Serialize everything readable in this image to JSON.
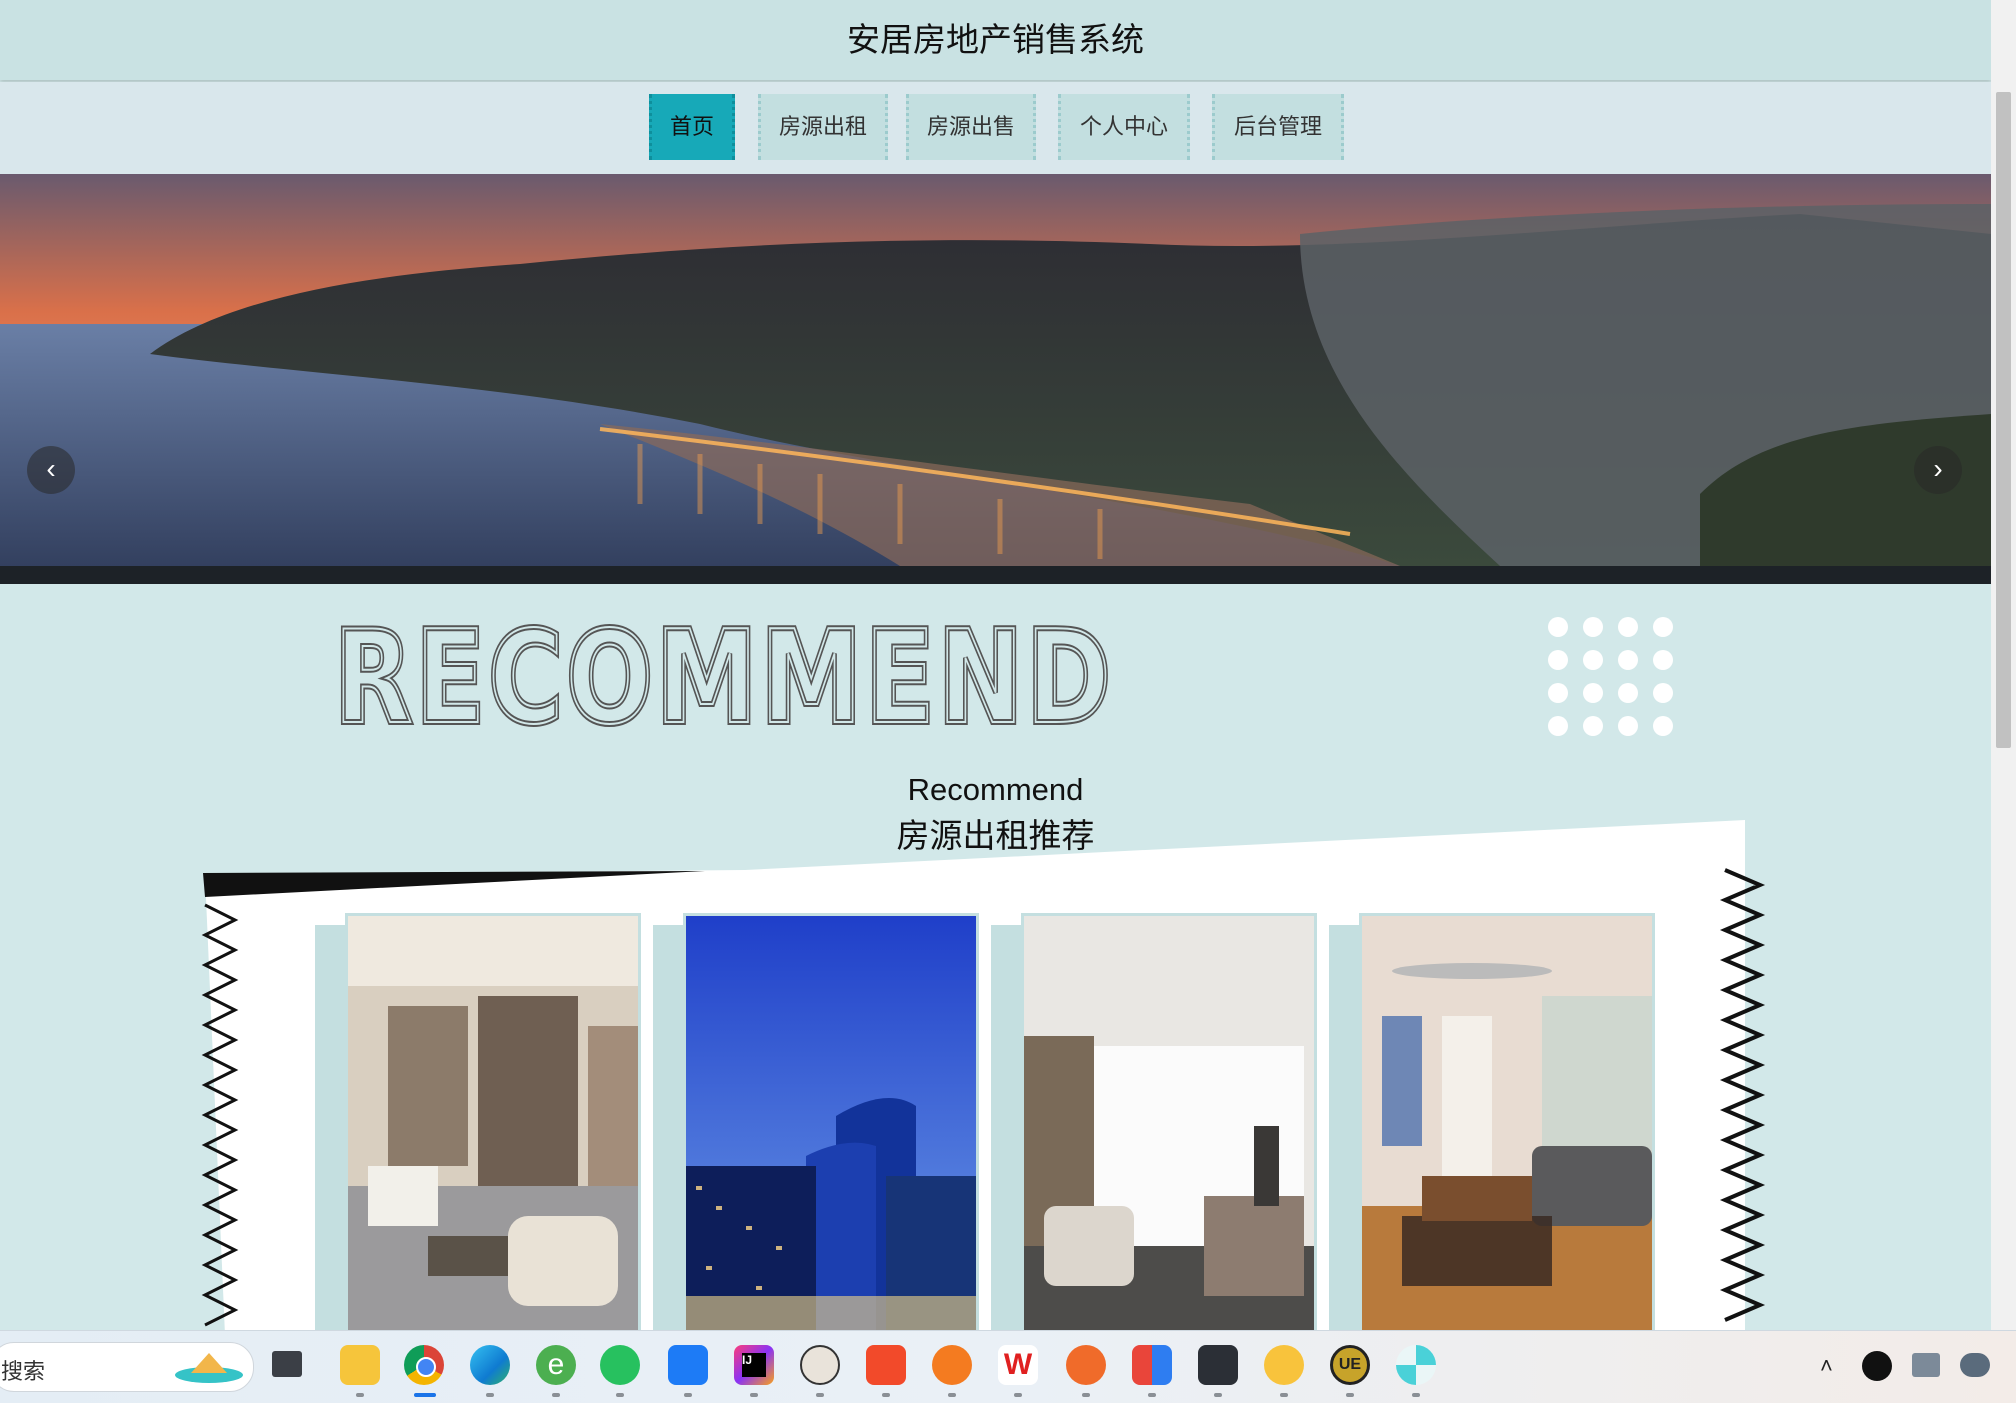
{
  "header": {
    "title": "安居房地产销售系统"
  },
  "nav": {
    "items": [
      {
        "label": "首页",
        "active": true
      },
      {
        "label": "房源出租",
        "active": false
      },
      {
        "label": "房源出售",
        "active": false
      },
      {
        "label": "个人中心",
        "active": false
      },
      {
        "label": "后台管理",
        "active": false
      }
    ]
  },
  "banner": {
    "prev_icon": "chevron-left-icon",
    "next_icon": "chevron-right-icon"
  },
  "recommend": {
    "word_art": "RECOMMEND",
    "title": "Recommend",
    "subtitle": "房源出租推荐"
  },
  "taskbar": {
    "search_text": "搜索",
    "colors": {
      "chrome": "#db4437",
      "edge": "#0f7bd1",
      "wechat": "#27c15f",
      "wps": "#e02020"
    }
  }
}
